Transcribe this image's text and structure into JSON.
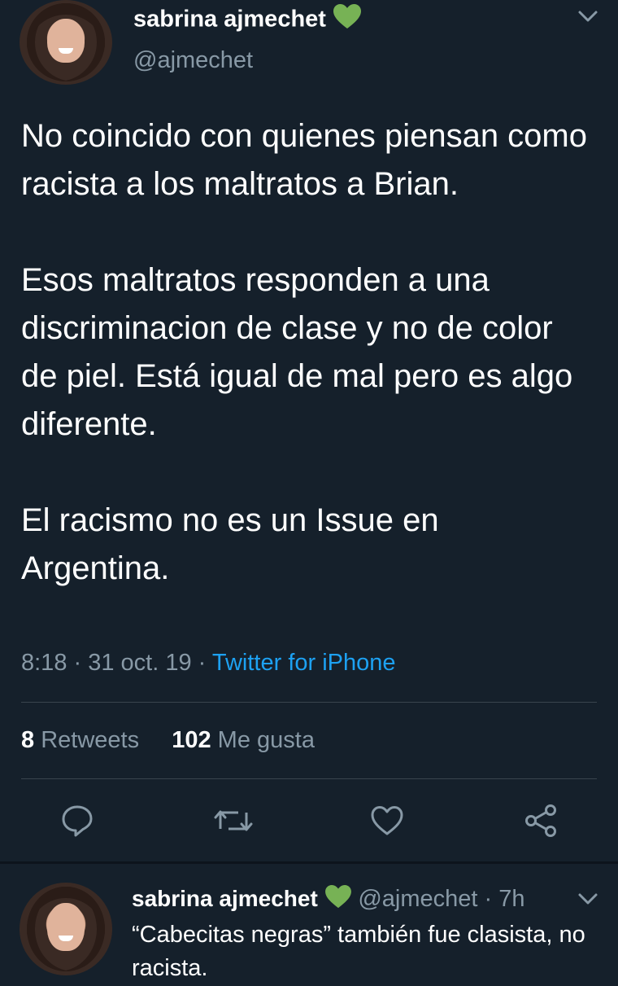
{
  "tweet": {
    "author_name": "sabrina ajmechet",
    "author_handle": "@ajmechet",
    "text": "No coincido con quienes piensan como racista a los maltratos a Brian.\n\nEsos maltratos responden a una discriminacion de clase y no de color de piel. Está igual de mal pero es algo diferente.\n\nEl racismo no es un Issue en Argentina.",
    "time": "8:18",
    "sep1": " · ",
    "date": "31 oct. 19",
    "sep2": " · ",
    "source": "Twitter for iPhone",
    "retweets_count": "8",
    "retweets_label": "Retweets",
    "likes_count": "102",
    "likes_label": "Me gusta"
  },
  "reply": {
    "author_name": "sabrina ajmechet",
    "author_handle": "@ajmechet",
    "separator": " · ",
    "time_ago": "7h",
    "text": "“Cabecitas negras” también fue clasista, no racista."
  },
  "icons": {
    "badge": "green-heart-icon",
    "menu": "chevron-down-icon",
    "actions": [
      "reply-icon",
      "retweet-icon",
      "like-icon",
      "share-icon"
    ]
  },
  "colors": {
    "background": "#15202b",
    "link": "#1da1f2",
    "secondary_text": "#8899a6",
    "divider": "#38444d",
    "heart_badge": "#77b255"
  }
}
